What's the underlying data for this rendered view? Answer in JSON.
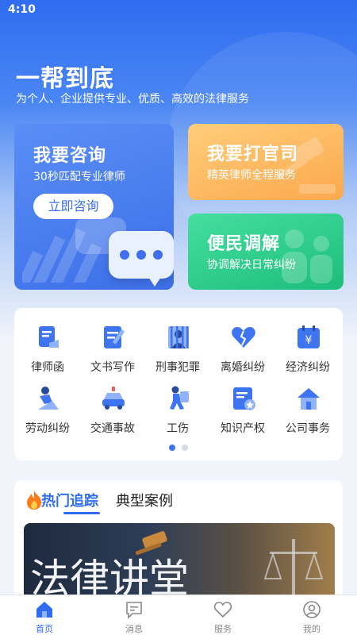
{
  "status_bar": {
    "time": "4:10"
  },
  "header": {
    "title": "一帮到底",
    "subtitle": "为个人、企业提供专业、优质、高效的法律服务"
  },
  "cards": {
    "consult": {
      "title": "我要咨询",
      "subtitle": "30秒匹配专业律师",
      "button_label": "立即咨询",
      "color": "#4a7ef1"
    },
    "lawsuit": {
      "title": "我要打官司",
      "subtitle": "精英律师全程服务",
      "color": "#fcb55c"
    },
    "mediate": {
      "title": "便民调解",
      "subtitle": "协调解决日常纠纷",
      "color": "#2fcf8c"
    }
  },
  "services": [
    {
      "label": "律师函",
      "icon": "lawyer-letter-icon"
    },
    {
      "label": "文书写作",
      "icon": "document-writing-icon"
    },
    {
      "label": "刑事犯罪",
      "icon": "criminal-icon"
    },
    {
      "label": "离婚纠纷",
      "icon": "broken-heart-icon"
    },
    {
      "label": "经济纠纷",
      "icon": "yen-calendar-icon"
    },
    {
      "label": "劳动纠纷",
      "icon": "labor-worker-icon"
    },
    {
      "label": "交通事故",
      "icon": "car-accident-icon"
    },
    {
      "label": "工伤",
      "icon": "injury-icon"
    },
    {
      "label": "知识产权",
      "icon": "ip-certificate-icon"
    },
    {
      "label": "公司事务",
      "icon": "company-house-icon"
    }
  ],
  "pager": {
    "pages": 2,
    "current": 1
  },
  "news": {
    "tabs": [
      {
        "label": "热门追踪",
        "active": true
      },
      {
        "label": "典型案例",
        "active": false
      }
    ],
    "banner_text": "法律讲堂"
  },
  "tabbar": [
    {
      "label": "首页",
      "icon": "home-icon",
      "active": true
    },
    {
      "label": "消息",
      "icon": "message-icon",
      "active": false
    },
    {
      "label": "服务",
      "icon": "heart-icon",
      "active": false
    },
    {
      "label": "我的",
      "icon": "profile-icon",
      "active": false
    }
  ],
  "colors": {
    "primary": "#2f6cf0",
    "background": "#f1f4fa"
  }
}
